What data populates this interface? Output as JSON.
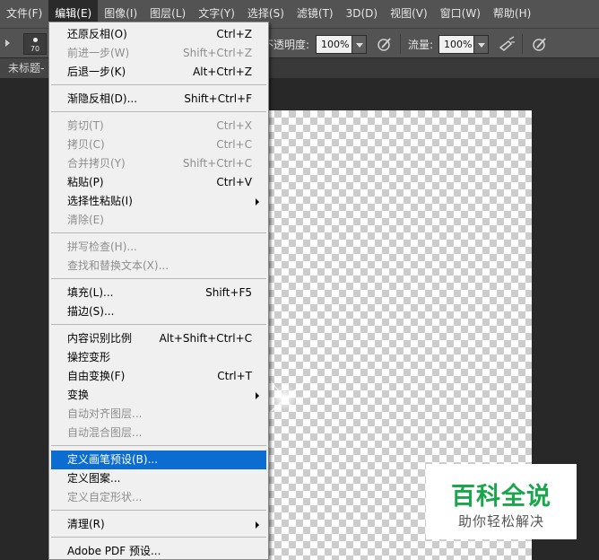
{
  "menubar": [
    "文件(F)",
    "编辑(E)",
    "图像(I)",
    "图层(L)",
    "文字(Y)",
    "选择(S)",
    "滤镜(T)",
    "3D(D)",
    "视图(V)",
    "窗口(W)",
    "帮助(H)"
  ],
  "options": {
    "brush_size": "70",
    "opacity_label": "不透明度:",
    "opacity_value": "100%",
    "flow_label": "流量:",
    "flow_value": "100%"
  },
  "document_tab": "未标题-",
  "menu": {
    "items": [
      {
        "label": "还原反相(O)",
        "shortcut": "Ctrl+Z",
        "disabled": false
      },
      {
        "label": "前进一步(W)",
        "shortcut": "Shift+Ctrl+Z",
        "disabled": true
      },
      {
        "label": "后退一步(K)",
        "shortcut": "Alt+Ctrl+Z",
        "disabled": false
      },
      {
        "label": "渐隐反相(D)...",
        "shortcut": "Shift+Ctrl+F",
        "disabled": false
      },
      {
        "label": "剪切(T)",
        "shortcut": "Ctrl+X",
        "disabled": true
      },
      {
        "label": "拷贝(C)",
        "shortcut": "Ctrl+C",
        "disabled": true
      },
      {
        "label": "合并拷贝(Y)",
        "shortcut": "Shift+Ctrl+C",
        "disabled": true
      },
      {
        "label": "粘贴(P)",
        "shortcut": "Ctrl+V",
        "disabled": false
      },
      {
        "label": "选择性粘贴(I)",
        "shortcut": "",
        "disabled": false,
        "submenu": true
      },
      {
        "label": "清除(E)",
        "shortcut": "",
        "disabled": true
      },
      {
        "label": "拼写检查(H)...",
        "shortcut": "",
        "disabled": true
      },
      {
        "label": "查找和替换文本(X)...",
        "shortcut": "",
        "disabled": true
      },
      {
        "label": "填充(L)...",
        "shortcut": "Shift+F5",
        "disabled": false
      },
      {
        "label": "描边(S)...",
        "shortcut": "",
        "disabled": false
      },
      {
        "label": "内容识别比例",
        "shortcut": "Alt+Shift+Ctrl+C",
        "disabled": false
      },
      {
        "label": "操控变形",
        "shortcut": "",
        "disabled": false
      },
      {
        "label": "自由变换(F)",
        "shortcut": "Ctrl+T",
        "disabled": false
      },
      {
        "label": "变换",
        "shortcut": "",
        "disabled": false,
        "submenu": true
      },
      {
        "label": "自动对齐图层...",
        "shortcut": "",
        "disabled": true
      },
      {
        "label": "自动混合图层...",
        "shortcut": "",
        "disabled": true
      },
      {
        "label": "定义画笔预设(B)...",
        "shortcut": "",
        "disabled": false,
        "highlighted": true
      },
      {
        "label": "定义图案...",
        "shortcut": "",
        "disabled": false
      },
      {
        "label": "定义自定形状...",
        "shortcut": "",
        "disabled": true
      },
      {
        "label": "清理(R)",
        "shortcut": "",
        "disabled": false,
        "submenu": true
      },
      {
        "label": "Adobe PDF 预设...",
        "shortcut": "",
        "disabled": false
      }
    ]
  },
  "watermark": {
    "title": "百科全说",
    "subtitle": "助你轻松解决"
  },
  "colors": {
    "menubar_bg": "#535353",
    "menu_bg": "#f0f0f0",
    "highlight": "#0b6dd1",
    "watermark_green": "#1aa64b",
    "workspace_bg": "#282828"
  }
}
